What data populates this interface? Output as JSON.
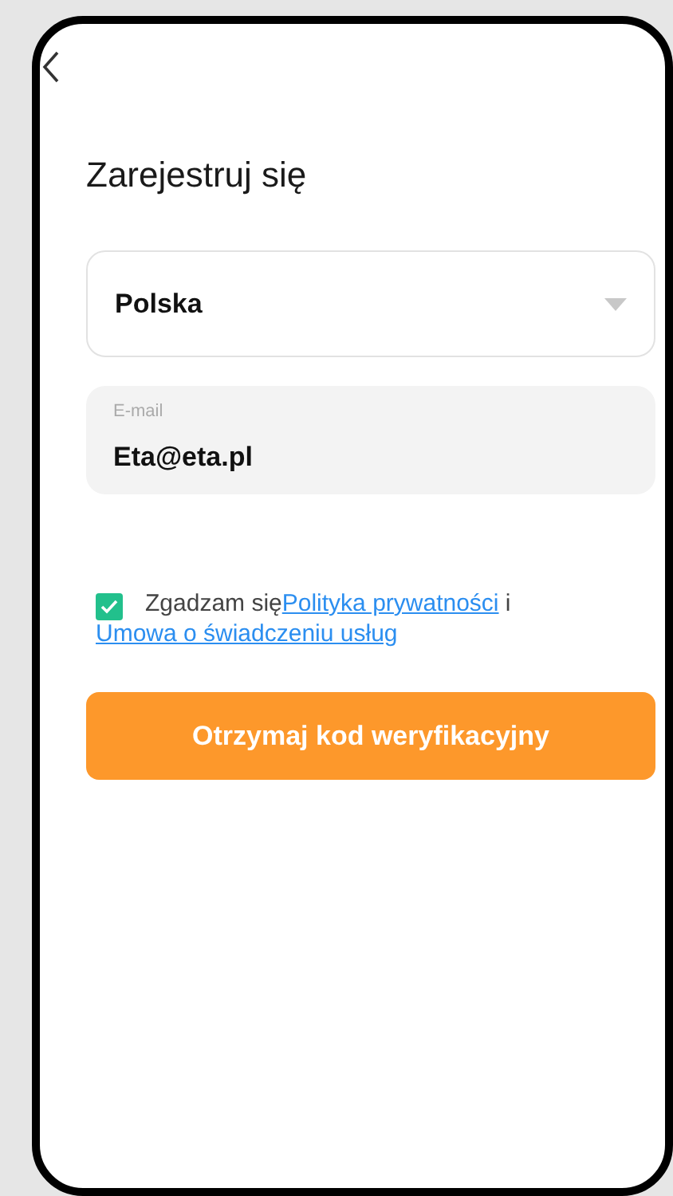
{
  "title": "Zarejestruj się",
  "country_select": {
    "value": "Polska"
  },
  "email_field": {
    "label": "E-mail",
    "value": "Eta@eta.pl"
  },
  "consent": {
    "checked": true,
    "text": "Zgadzam się",
    "links": [
      {
        "label": "Polityka prywatności"
      },
      {
        "label": "Umowa o świadczeniu usług"
      }
    ],
    "joiner": "i"
  },
  "submit_button": {
    "label": "Otrzymaj kod weryfikacyjny"
  }
}
